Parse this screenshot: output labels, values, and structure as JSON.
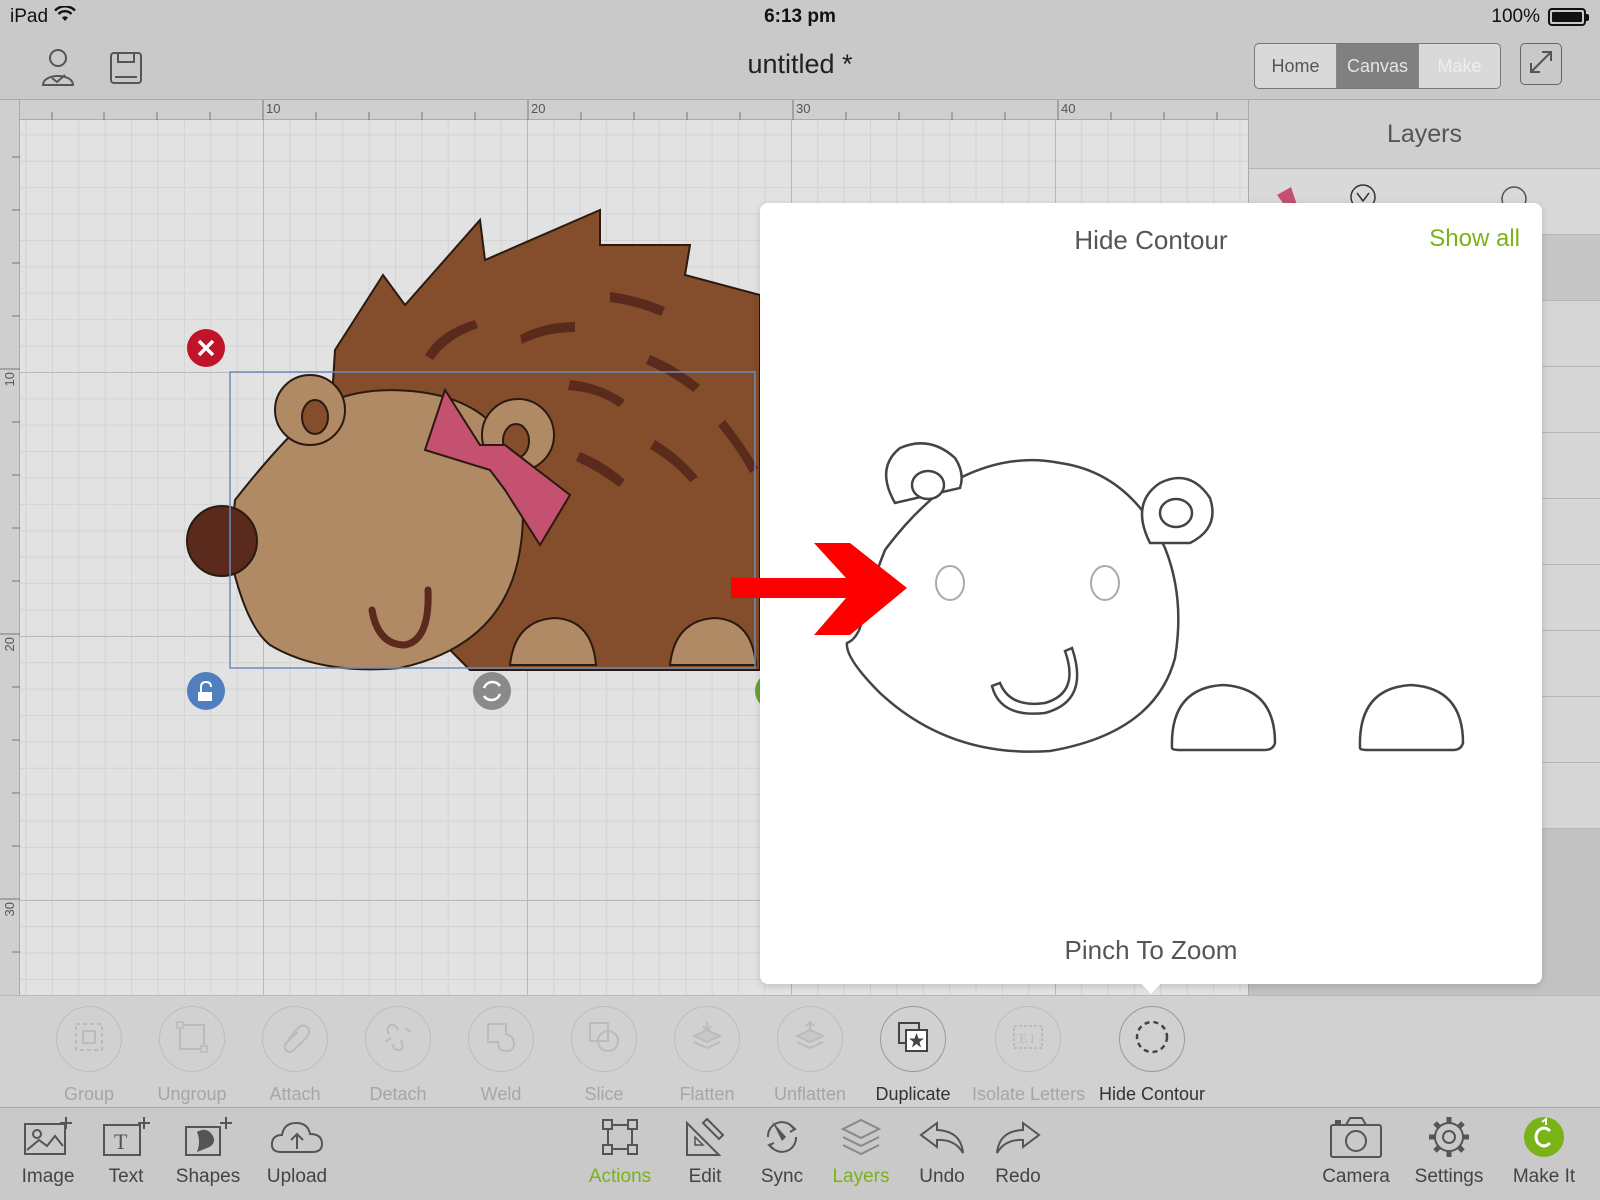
{
  "status_bar": {
    "device": "iPad",
    "time": "6:13 pm",
    "battery": "100%",
    "battery_level": 1.0
  },
  "top_bar": {
    "title": "untitled *",
    "tabs": [
      {
        "label": "Home",
        "state": "normal"
      },
      {
        "label": "Canvas",
        "state": "active"
      },
      {
        "label": "Make",
        "state": "disabled"
      }
    ]
  },
  "rulers": {
    "top": [
      "10",
      "20",
      "30",
      "40"
    ],
    "left": [
      "10",
      "20",
      "30"
    ]
  },
  "layers_panel": {
    "title": "Layers"
  },
  "popover": {
    "title": "Hide Contour",
    "show_all": "Show all",
    "hint": "Pinch To Zoom"
  },
  "actions": [
    {
      "label": "Group",
      "icon": "group-icon",
      "enabled": false
    },
    {
      "label": "Ungroup",
      "icon": "ungroup-icon",
      "enabled": false
    },
    {
      "label": "Attach",
      "icon": "paperclip-icon",
      "enabled": false
    },
    {
      "label": "Detach",
      "icon": "detach-icon",
      "enabled": false
    },
    {
      "label": "Weld",
      "icon": "weld-icon",
      "enabled": false
    },
    {
      "label": "Slice",
      "icon": "slice-icon",
      "enabled": false
    },
    {
      "label": "Flatten",
      "icon": "flatten-icon",
      "enabled": false
    },
    {
      "label": "Unflatten",
      "icon": "unflatten-icon",
      "enabled": false
    },
    {
      "label": "Duplicate",
      "icon": "duplicate-icon",
      "enabled": true
    },
    {
      "label": "Isolate Letters",
      "icon": "isolate-letters-icon",
      "enabled": false
    },
    {
      "label": "Hide Contour",
      "icon": "hide-contour-icon",
      "enabled": true
    }
  ],
  "toolbar": {
    "left": [
      {
        "label": "Image",
        "icon": "image-icon"
      },
      {
        "label": "Text",
        "icon": "text-icon"
      },
      {
        "label": "Shapes",
        "icon": "shapes-icon"
      },
      {
        "label": "Upload",
        "icon": "upload-cloud-icon"
      }
    ],
    "center": [
      {
        "label": "Actions",
        "icon": "actions-icon",
        "active": true
      },
      {
        "label": "Edit",
        "icon": "edit-icon",
        "active": false
      },
      {
        "label": "Sync",
        "icon": "sync-icon",
        "active": false
      },
      {
        "label": "Layers",
        "icon": "layers-icon",
        "active": true
      },
      {
        "label": "Undo",
        "icon": "undo-icon",
        "active": false
      },
      {
        "label": "Redo",
        "icon": "redo-icon",
        "active": false
      }
    ],
    "right": [
      {
        "label": "Camera",
        "icon": "camera-icon"
      },
      {
        "label": "Settings",
        "icon": "gear-icon"
      },
      {
        "label": "Make It",
        "icon": "make-it-icon"
      }
    ]
  },
  "colors": {
    "accent": "#7ab317",
    "hedgehog_body": "#844d2b",
    "hedgehog_face": "#b08a64",
    "hedgehog_dark": "#5a2a1c",
    "bow": "#c4516f",
    "delete_handle": "#c0142a",
    "lock_handle": "#4f7fbf",
    "arrow": "#ff0000"
  }
}
